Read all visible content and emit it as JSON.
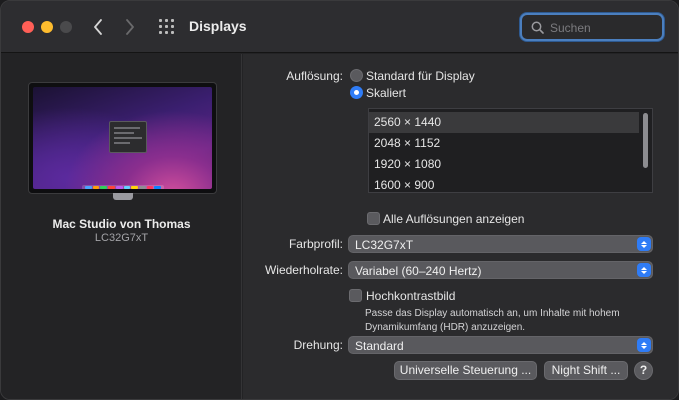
{
  "window": {
    "title": "Displays",
    "search_placeholder": "Suchen"
  },
  "toolbar_icons": [
    "chevron-left-icon",
    "chevron-right-icon",
    "grid-icon",
    "search-icon"
  ],
  "display": {
    "name": "Mac Studio von Thomas",
    "model": "LC32G7xT"
  },
  "resolution": {
    "label": "Auflösung:",
    "option_default": "Standard für Display",
    "option_scaled": "Skaliert",
    "selected_option": "Skaliert",
    "list": [
      "2560 × 1440",
      "2048 × 1152",
      "1920 × 1080",
      "1600 × 900"
    ],
    "selected_resolution": "2560 × 1440",
    "show_all_label": "Alle Auflösungen anzeigen"
  },
  "color_profile": {
    "label": "Farbprofil:",
    "value": "LC32G7xT"
  },
  "refresh_rate": {
    "label": "Wiederholrate:",
    "value": "Variabel (60–240 Hertz)"
  },
  "high_contrast": {
    "label": "Hochkontrastbild",
    "description_line1": "Passe das Display automatisch an, um Inhalte mit hohem",
    "description_line2": "Dynamikumfang (HDR) anzuzeigen."
  },
  "rotation": {
    "label": "Drehung:",
    "value": "Standard"
  },
  "buttons": {
    "universal_control": "Universelle Steuerung ...",
    "night_shift": "Night Shift ...",
    "help": "?"
  },
  "colors": {
    "accent": "#2f7cf6",
    "close": "#ff5f57",
    "minimize": "#febc2e",
    "focus_ring": "#4b7fbf"
  }
}
